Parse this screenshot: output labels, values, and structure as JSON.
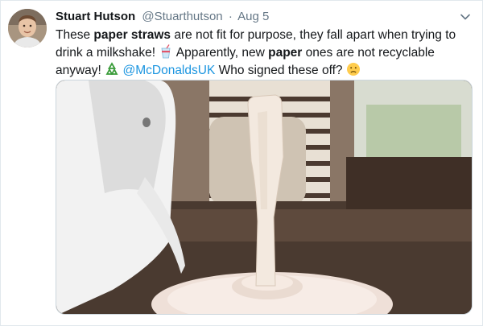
{
  "tweet": {
    "display_name": "Stuart Hutson",
    "handle": "@Stuarthutson",
    "separator": "·",
    "date": "Aug 5",
    "text": {
      "t1": "These ",
      "b1": "paper straws",
      "t2": " are not fit for purpose, they fall apart when trying to drink a milkshake! ",
      "t3": " Apparently, new ",
      "b2": "paper",
      "t4": " ones are not recyclable anyway! ",
      "mention": "@McDonaldsUK",
      "t5": " Who signed these off? "
    }
  },
  "icons": {
    "caret": "chevron-down-icon",
    "emoji1": "cup-with-straw-icon",
    "emoji2": "recycling-symbol-icon",
    "emoji3": "slightly-frowning-face-icon"
  },
  "colors": {
    "link": "#1b95e0",
    "secondary_text": "#657786",
    "border": "#e1e8ed"
  }
}
